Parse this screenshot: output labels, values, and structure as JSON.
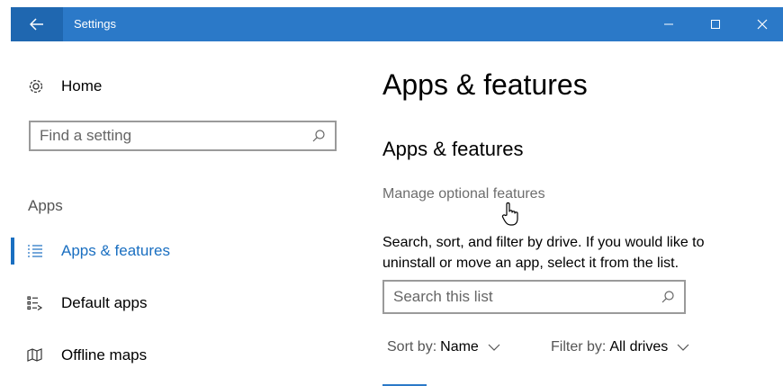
{
  "window": {
    "title": "Settings",
    "titlebar_color": "#2b79c8",
    "back_icon": "arrow-left-icon",
    "controls": [
      "minimize-icon",
      "maximize-icon",
      "close-icon"
    ]
  },
  "sidebar": {
    "home": {
      "label": "Home",
      "icon": "gear-icon"
    },
    "search": {
      "placeholder": "Find a setting",
      "value": "",
      "icon": "search-icon"
    },
    "section_label": "Apps",
    "items": [
      {
        "label": "Apps & features",
        "icon": "list-icon",
        "active": true
      },
      {
        "label": "Default apps",
        "icon": "default-apps-icon",
        "active": false
      },
      {
        "label": "Offline maps",
        "icon": "map-icon",
        "active": false
      }
    ]
  },
  "main": {
    "page_title": "Apps & features",
    "section_title": "Apps & features",
    "manage_link": "Manage optional features",
    "description": "Search, sort, and filter by drive. If you would like to uninstall or move an app, select it from the list.",
    "search": {
      "placeholder": "Search this list",
      "value": "",
      "icon": "search-icon"
    },
    "sort": {
      "label": "Sort by:",
      "value": "Name"
    },
    "filter": {
      "label": "Filter by:",
      "value": "All drives"
    }
  },
  "colors": {
    "accent": "#1a6fc1",
    "titlebar": "#2b79c8",
    "secondary_text": "#6d6d6d"
  }
}
